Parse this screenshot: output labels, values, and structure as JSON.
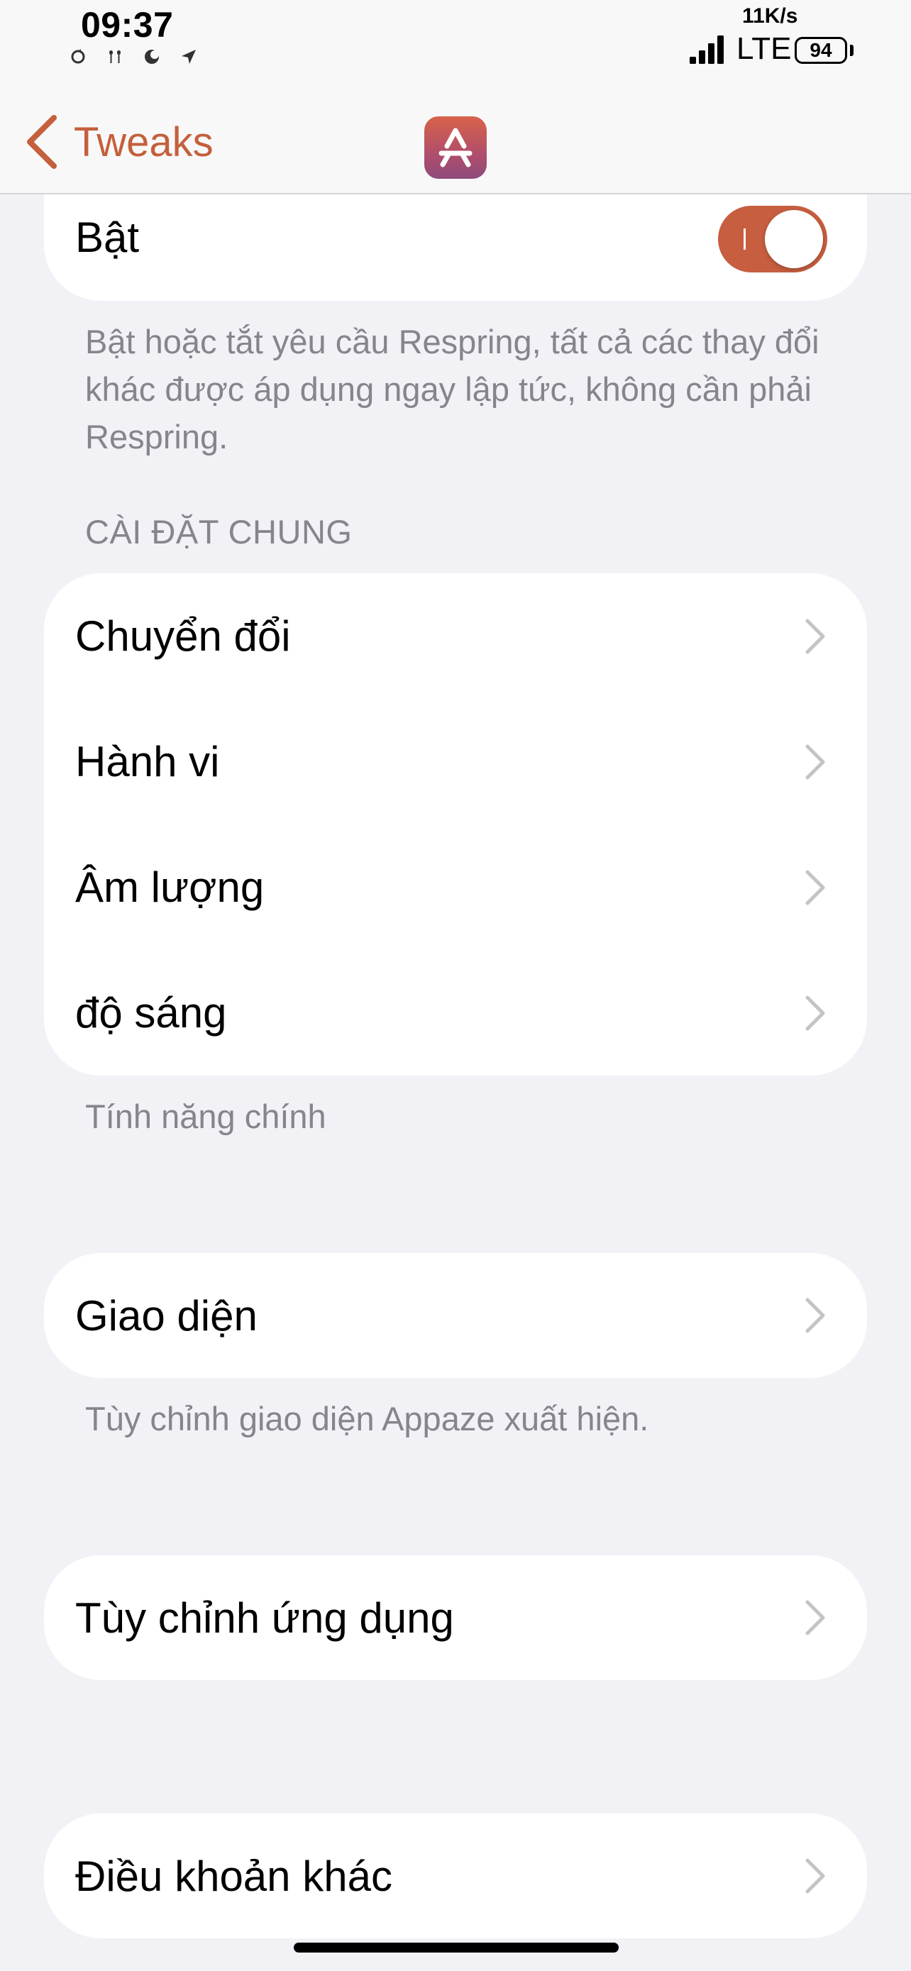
{
  "status_bar": {
    "time": "09:37",
    "network_speed": "11K/s",
    "network_type": "LTE",
    "battery": "94",
    "left_icons": [
      "sync-icon",
      "airpods-icon",
      "focus-moon-icon",
      "location-arrow-icon"
    ]
  },
  "nav": {
    "back_label": "Tweaks",
    "app_icon": "appaze-logo-icon",
    "accent_color": "#c65e3f"
  },
  "enable_section": {
    "toggle_label": "Bật",
    "toggle_on": true,
    "footer": "Bật hoặc tắt yêu cầu Respring, tất cả các thay đổi khác được áp dụng ngay lập tức, không cần phải Respring."
  },
  "general_section": {
    "header": "CÀI ĐẶT CHUNG",
    "items": [
      {
        "label": "Chuyển đổi"
      },
      {
        "label": "Hành vi"
      },
      {
        "label": "Âm lượng"
      },
      {
        "label": "độ sáng"
      }
    ],
    "footer": "Tính năng chính"
  },
  "appearance_section": {
    "item": "Giao diện",
    "footer": "Tùy chỉnh giao diện Appaze xuất hiện."
  },
  "app_custom_section": {
    "item": "Tùy chỉnh ứng dụng"
  },
  "other_terms_section": {
    "item": "Điều khoản khác"
  }
}
